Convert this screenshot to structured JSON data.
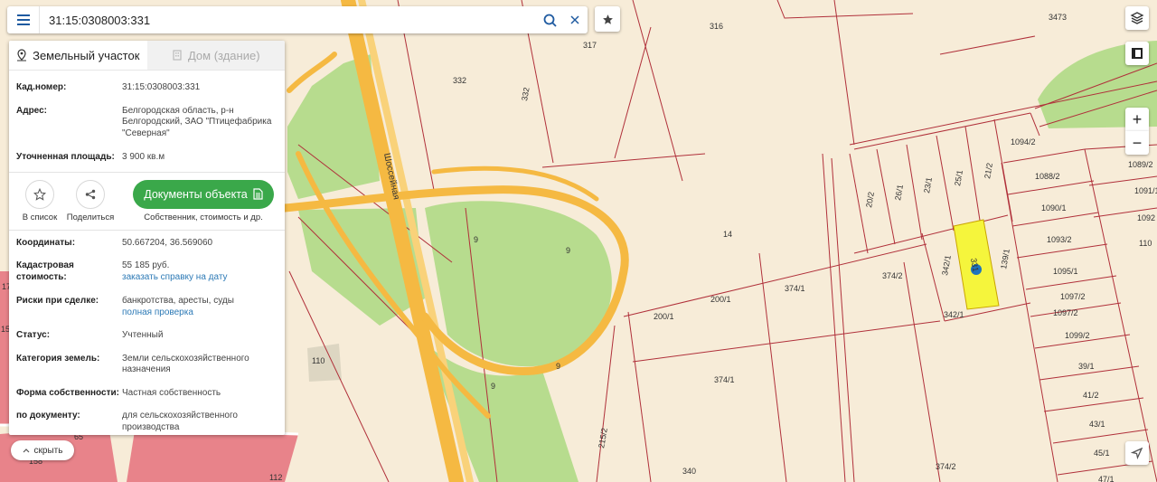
{
  "search": {
    "value": "31:15:0308003:331"
  },
  "tabs": [
    {
      "label": "Земельный участок"
    },
    {
      "label": "Дом (здание)"
    }
  ],
  "details": {
    "cad_label": "Кад.номер:",
    "cad_value": "31:15:0308003:331",
    "address_label": "Адрес:",
    "address_value": "Белгородская область, р-н Белгородский, ЗАО \"Птицефабрика \"Северная\"",
    "area_label": "Уточненная площадь:",
    "area_value": "3 900 кв.м"
  },
  "actions": {
    "add_list_label": "В список",
    "share_label": "Поделиться",
    "docs_button_label": "Документы объекта",
    "docs_sub_label": "Собственник, стоимость и др."
  },
  "info": {
    "coords_label": "Координаты:",
    "coords_value": "50.667204, 36.569060",
    "cost_label": "Кадастровая стоимость:",
    "cost_value": "55 185 руб.",
    "cost_link": "заказать справку на дату",
    "risks_label": "Риски при сделке:",
    "risks_value": "банкротства, аресты, суды",
    "risks_link": "полная проверка",
    "status_label": "Статус:",
    "status_value": "Учтенный",
    "category_label": "Категория земель:",
    "category_value": "Земли сельскохозяйственного назначения",
    "ownership_label": "Форма собственности:",
    "ownership_value": "Частная собственность",
    "doc_label": "по документу:",
    "doc_value": "для сельскохозяйственного производства"
  },
  "hide_label": "скрыть",
  "map": {
    "street_label": "Шоссейная",
    "parcel_labels": [
      "316",
      "317",
      "332",
      "332",
      "3473",
      "14",
      "9",
      "9",
      "9",
      "9",
      "374/1",
      "374/2",
      "200/1",
      "200/1",
      "374/1",
      "215/2",
      "340",
      "374/2",
      "20/2",
      "26/1",
      "23/1",
      "25/1",
      "21/2",
      "342/1",
      "342/1",
      "139/1",
      "331",
      "1094/2",
      "1088/2",
      "1090/1",
      "1093/2",
      "1095/1",
      "1097/2",
      "1097/2",
      "1099/2",
      "39/1",
      "41/2",
      "43/1",
      "45/1",
      "47/1",
      "1089/2",
      "1091/1",
      "1092",
      "110",
      "110",
      "65",
      "158",
      "112",
      "17",
      "15"
    ],
    "colors": {
      "background": "#f7ecd8",
      "parcel_line": "#b0303a",
      "road": "#f5b942",
      "green": "#b7dc8e",
      "building": "#e8838a",
      "selected": "#f5f53c",
      "marker": "#1e73be"
    }
  },
  "controls": {
    "zoom_in": "+",
    "zoom_out": "−"
  }
}
